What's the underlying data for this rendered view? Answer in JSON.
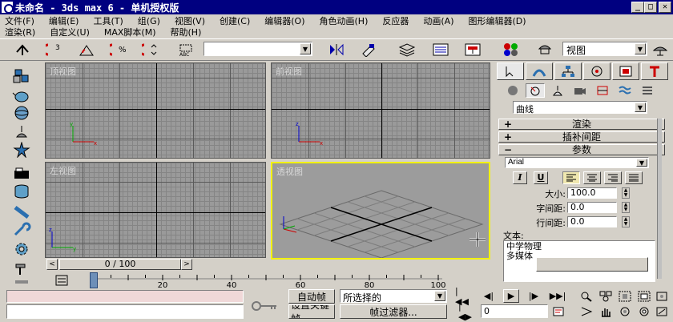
{
  "window": {
    "title": "未命名 - 3ds max 6 - 单机授权版",
    "minimize": "_",
    "maximize": "□",
    "close": "✕"
  },
  "menu": {
    "row1": [
      "文件(F)",
      "编辑(E)",
      "工具(T)",
      "组(G)",
      "视图(V)",
      "创建(C)",
      "编辑器(O)",
      "角色动画(H)",
      "反应器",
      "动画(A)",
      "图形编辑器(D)"
    ],
    "row2": [
      "渲染(R)",
      "自定义(U)",
      "MAX脚本(M)",
      "帮助(H)"
    ]
  },
  "toolbar": {
    "selection_set_value": "",
    "view_dropdown": "视图",
    "snap_label": "3",
    "percent_label": "%"
  },
  "viewports": {
    "top": "顶视图",
    "front": "前视图",
    "left": "左视图",
    "perspective": "透视图"
  },
  "panel": {
    "category": "曲线",
    "rollouts": {
      "render": "渲染",
      "interpolation": "插补间距",
      "parameters": "参数"
    },
    "font": "Arial",
    "italic": "I",
    "underline": "U",
    "size_label": "大小:",
    "size_value": "100.0",
    "kerning_label": "字间距:",
    "kerning_value": "0.0",
    "leading_label": "行间距:",
    "leading_value": "0.0",
    "text_label": "文本:",
    "text_lines": [
      "中学物理",
      "多媒体"
    ]
  },
  "timeline": {
    "frame_display": "0 / 100",
    "prev": "<",
    "next": ">",
    "ruler_ticks": [
      "0",
      "20",
      "40",
      "60",
      "80",
      "100"
    ]
  },
  "status": {
    "auto_key": "自动帧",
    "set_key": "设置关键帧",
    "selection_mode": "所选择的",
    "key_filters": "帧过滤器...",
    "frame_input": "0"
  },
  "colors": {
    "titlebar": "#000080",
    "face": "#d4d0c8",
    "viewport": "#9a9a9a",
    "active_viewport_border": "#f2f200",
    "status_pink": "#f0d8d8"
  }
}
